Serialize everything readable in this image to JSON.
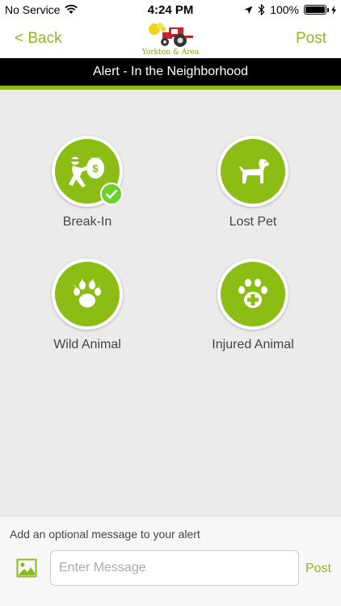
{
  "status_bar": {
    "carrier": "No Service",
    "time": "4:24 PM",
    "battery": "100%",
    "battery_level": 1.0
  },
  "nav": {
    "back_label": "< Back",
    "post_label": "Post",
    "logo_text": "Yorkton & Area"
  },
  "title": "Alert - In the Neighborhood",
  "options": [
    {
      "label": "Break-In",
      "icon": "burglar-icon",
      "selected": true
    },
    {
      "label": "Lost Pet",
      "icon": "dog-icon",
      "selected": false
    },
    {
      "label": "Wild Animal",
      "icon": "paw-icon",
      "selected": false
    },
    {
      "label": "Injured Animal",
      "icon": "paw-cross-icon",
      "selected": false
    }
  ],
  "bottom": {
    "hint": "Add an optional message to your alert",
    "placeholder": "Enter Message",
    "send_label": "Post"
  },
  "colors": {
    "accent": "#8dba1b",
    "circle": "#8cbd15",
    "check": "#6ed12a",
    "title_bg": "#000000"
  }
}
